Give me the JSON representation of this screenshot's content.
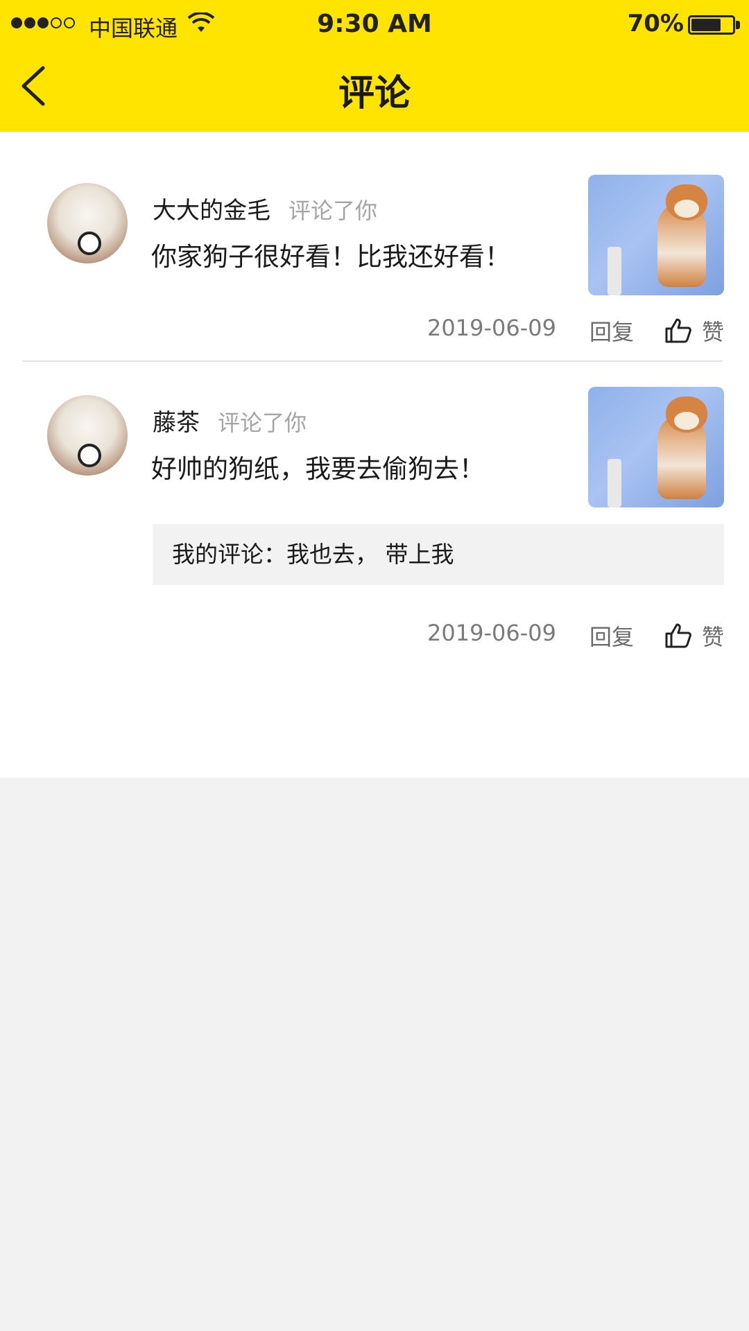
{
  "status_bar": {
    "carrier": "中国联通",
    "time": "9:30 AM",
    "battery": "70%",
    "battery_level": 0.7,
    "signal_bars": 3,
    "wifi_icon": "wifi-icon"
  },
  "header": {
    "title": "评论",
    "back_icon": "chevron-left-icon",
    "background_color": "#ffe400"
  },
  "comments": [
    {
      "username": "大大的金毛",
      "action": "评论了你",
      "content": "你家狗子很好看！比我还好看！",
      "date": "2019-06-09",
      "reply_label": "回复",
      "like_label": "赞"
    },
    {
      "username": "藤茶",
      "action": "评论了你",
      "content": "好帅的狗纸，我要去偷狗去！",
      "my_comment": "我的评论：我也去， 带上我",
      "date": "2019-06-09",
      "reply_label": "回复",
      "like_label": "赞"
    }
  ]
}
